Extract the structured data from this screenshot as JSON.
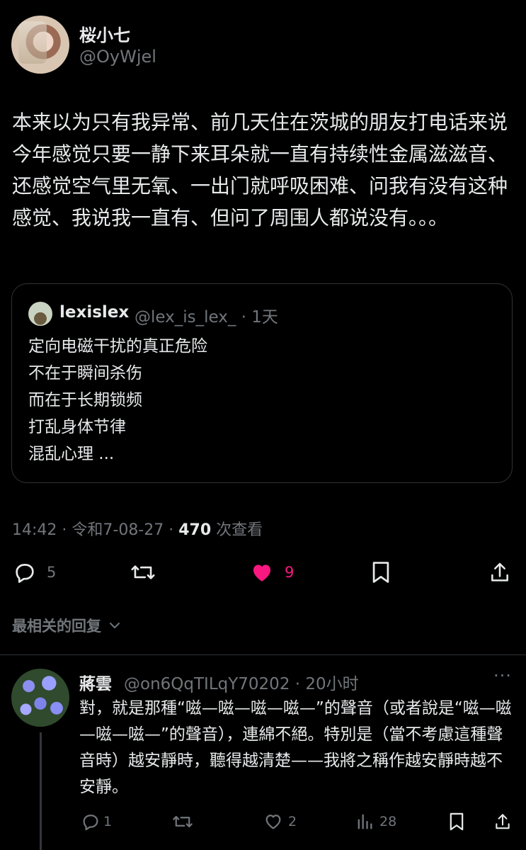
{
  "post": {
    "display_name": "桜小七",
    "handle": "@OyWjel",
    "text": "本来以为只有我异常、前几天住在茨城的朋友打电话来说今年感觉只要一静下来耳朵就一直有持续性金属滋滋音、还感觉空气里无氧、一出门就呼吸困难、问我有没有这种感觉、我说我一直有、但问了周围人都说没有。。。",
    "quote": {
      "name": "lexislex",
      "meta": "@lex_is_lex_ · 1天",
      "lines": [
        "定向电磁干扰的真正危险",
        "不在于瞬间杀伤",
        "而在于长期锁频",
        "打乱身体节律",
        "混乱心理 ..."
      ]
    },
    "timestamp": "14:42 · 令和7-08-27 · ",
    "views_count": "470",
    "views_label": " 次查看",
    "actions": {
      "replies": "5",
      "likes": "9"
    },
    "colors": {
      "like": "#f91880",
      "muted": "#71767b",
      "text": "#e7e9ea"
    }
  },
  "replies_section": {
    "title": "最相关的回复"
  },
  "reply": {
    "name": "蔣雲",
    "meta": "@on6QqTILqY70202 · 20小时",
    "more": "···",
    "text": "對，就是那種“嗞—嗞—嗞—嗞—”的聲音（或者說是“嗞—嗞—嗞—嗞—”的聲音），連綿不絕。特別是（當不考慮這種聲音時）越安靜時，聽得越清楚——我將之稱作越安靜時越不安靜。",
    "actions": {
      "replies": "1",
      "likes": "2",
      "views": "28"
    }
  },
  "icons": [
    "reply-icon",
    "retweet-icon",
    "heart-icon",
    "bookmark-icon",
    "share-icon",
    "analytics-icon",
    "chevron-down-icon",
    "more-icon"
  ]
}
